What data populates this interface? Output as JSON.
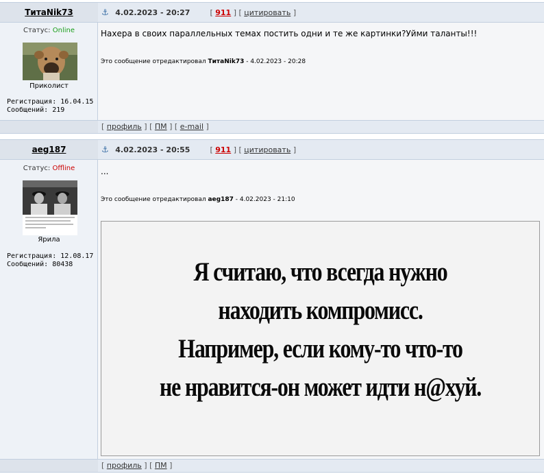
{
  "posts": [
    {
      "username": "ТитаNik73",
      "date": "4.02.2023 - 20:27",
      "post_number": "911",
      "quote_label": "цитировать",
      "status_label": "Статус:",
      "status_value": "Online",
      "user_title": "Приколист",
      "reg_line": "Регистрация: 16.04.15",
      "msgs_line": "Сообщений: 219",
      "message": "Нахера в своих параллельных темах постить одни и те же картинки?Уйми таланты!!!",
      "edit_prefix": "Это сообщение отредактировал",
      "edit_user": "ТитаNik73",
      "edit_date": "- 4.02.2023 - 20:28",
      "footer_links": [
        "профиль",
        "ПМ",
        "e-mail"
      ]
    },
    {
      "username": "aeg187",
      "date": "4.02.2023 - 20:55",
      "post_number": "911",
      "quote_label": "цитировать",
      "status_label": "Статус:",
      "status_value": "Offline",
      "user_title": "Ярила",
      "reg_line": "Регистрация: 12.08.17",
      "msgs_line": "Сообщений: 80438",
      "message": "...",
      "edit_prefix": "Это сообщение отредактировал",
      "edit_user": "aeg187",
      "edit_date": "- 4.02.2023 - 21:10",
      "image_text": [
        "Я считаю, что всегда нужно",
        "находить компромисс.",
        "Например,  если кому-то что-то",
        "не нравится-он может идти н@хуй."
      ],
      "footer_links": [
        "профиль",
        "ПМ"
      ]
    }
  ],
  "colors": {
    "header_bg": "#e4eaf2",
    "online": "#1b9e1b",
    "offline": "#cc0000",
    "post_number": "#cc0000"
  }
}
